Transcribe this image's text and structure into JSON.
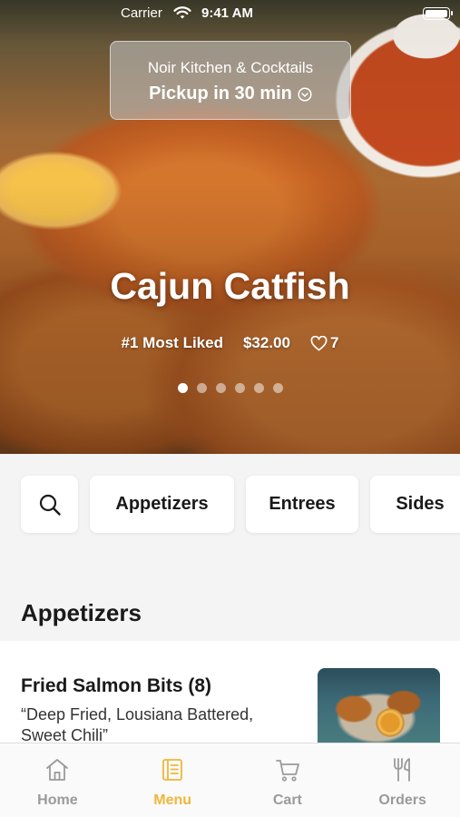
{
  "status_bar": {
    "carrier": "Carrier",
    "time": "9:41 AM",
    "icons": [
      "wifi-icon",
      "battery-icon"
    ]
  },
  "pickup": {
    "restaurant": "Noir Kitchen & Cocktails",
    "time_label": "Pickup in 30 min",
    "icon": "chevron-down-circle-icon"
  },
  "featured": {
    "title": "Cajun Catfish",
    "rank": "#1 Most Liked",
    "price": "$32.00",
    "likes": "7",
    "carousel_pages": 6,
    "carousel_active": 1
  },
  "categories": {
    "search_icon": "search-icon",
    "items": [
      "Appetizers",
      "Entrees",
      "Sides"
    ]
  },
  "menu": {
    "section_title": "Appetizers",
    "items": [
      {
        "name": "Fried Salmon Bits (8)",
        "description": "“Deep Fried, Lousiana Battered, Sweet Chili”"
      }
    ]
  },
  "tab_bar": {
    "tabs": [
      {
        "label": "Home",
        "icon": "home-icon"
      },
      {
        "label": "Menu",
        "icon": "menu-icon"
      },
      {
        "label": "Cart",
        "icon": "cart-icon"
      },
      {
        "label": "Orders",
        "icon": "fork-knife-icon"
      }
    ],
    "active_index": 1
  },
  "colors": {
    "accent": "#f0b63a",
    "inactive_tab": "#9a9a9a",
    "background": "#f4f4f4"
  }
}
